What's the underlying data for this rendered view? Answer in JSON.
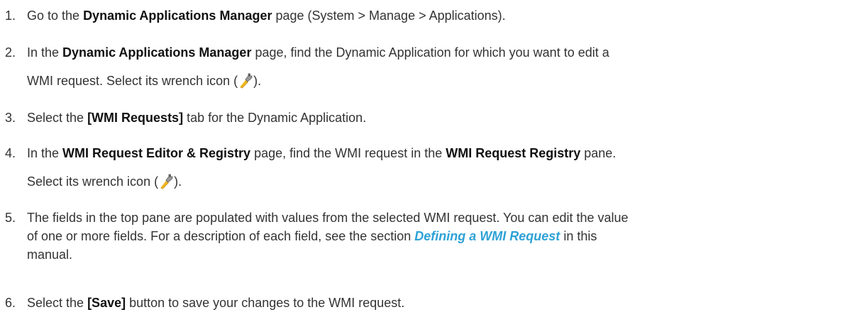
{
  "steps": [
    {
      "number": "1.",
      "pre": "Go to the ",
      "bold1": "Dynamic Applications Manager",
      "post": " page (System > Manage > Applications)."
    },
    {
      "number": "2.",
      "pre": "In the ",
      "bold1": "Dynamic Applications Manager",
      "mid": " page, find the Dynamic Application for which you want to edit a",
      "line2_pre": "WMI request. Select its wrench icon (",
      "line2_post": ").",
      "icon": "wrench-icon"
    },
    {
      "number": "3.",
      "pre": "Select the ",
      "bold1": "[WMI Requests]",
      "post": " tab for the Dynamic Application."
    },
    {
      "number": "4.",
      "pre": "In the ",
      "bold1": "WMI Request Editor & Registry",
      "mid": " page, find the WMI request in the ",
      "bold2": "WMI Request Registry",
      "post": " pane.",
      "line2_pre": "Select its wrench icon (",
      "line2_post": ").",
      "icon": "wrench-icon"
    },
    {
      "number": "5.",
      "line1": "The fields in the top pane are populated with values from the selected WMI request. You can edit the value",
      "line2_pre": "of one or more fields. For a description of each field, see the section ",
      "link": "Defining a WMI Request",
      "line2_post": " in this",
      "line3": "manual."
    },
    {
      "number": "6.",
      "pre": "Select the ",
      "bold1": "[Save]",
      "post": " button to save your changes to the WMI request."
    }
  ],
  "colors": {
    "text": "#333333",
    "link": "#2ea1d6",
    "wrench_body": "#f5b81c",
    "wrench_head": "#8a8a8a"
  }
}
